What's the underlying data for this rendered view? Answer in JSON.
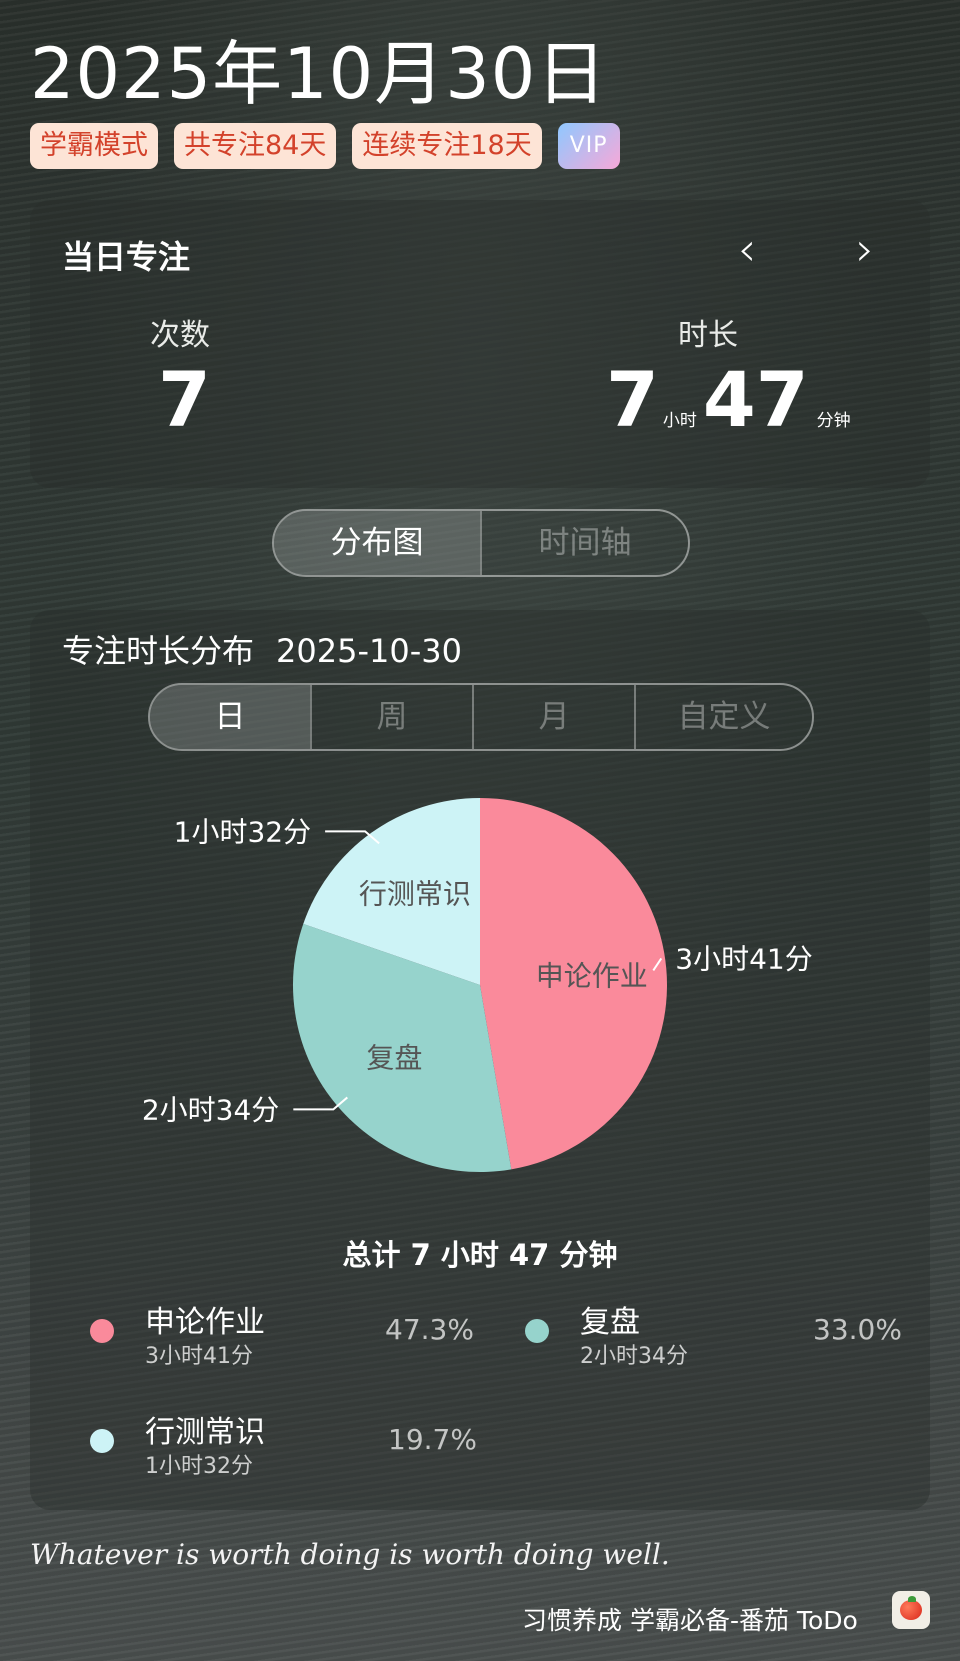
{
  "header": {
    "date": "2025年10月30日",
    "badges": [
      "学霸模式",
      "共专注84天",
      "连续专注18天"
    ],
    "vip_label": "VIP"
  },
  "focus_summary": {
    "title": "当日专注",
    "prev_icon": "chevron-left-icon",
    "next_icon": "chevron-right-icon",
    "prev_symbol": "‹",
    "next_symbol": "›",
    "count_label": "次数",
    "count_value": "7",
    "duration_label": "时长",
    "hours": "7",
    "hours_unit": "小时",
    "minutes": "47",
    "minutes_unit": "分钟"
  },
  "view_toggle": {
    "options": [
      "分布图",
      "时间轴"
    ],
    "selected": "分布图"
  },
  "distribution": {
    "title": "专注时长分布",
    "date": "2025-10-30",
    "period_options": [
      "日",
      "周",
      "月",
      "自定义"
    ],
    "selected_period": "日",
    "total_text": "总计 7 小时 47 分钟"
  },
  "chart_data": {
    "type": "pie",
    "slices": [
      {
        "name": "申论作业",
        "value_minutes": 221,
        "label": "3小时41分",
        "percent": "47.3%",
        "color": "#fa8a9b"
      },
      {
        "name": "复盘",
        "value_minutes": 154,
        "label": "2小时34分",
        "percent": "33.0%",
        "color": "#96d3cc"
      },
      {
        "name": "行测常识",
        "value_minutes": 92,
        "label": "1小时32分",
        "percent": "19.7%",
        "color": "#cdf3f6"
      }
    ]
  },
  "footer": {
    "quote": "Whatever is worth doing is worth doing well.",
    "brand": "习惯养成 学霸必备-番茄 ToDo",
    "app_icon": "tomato-icon"
  }
}
